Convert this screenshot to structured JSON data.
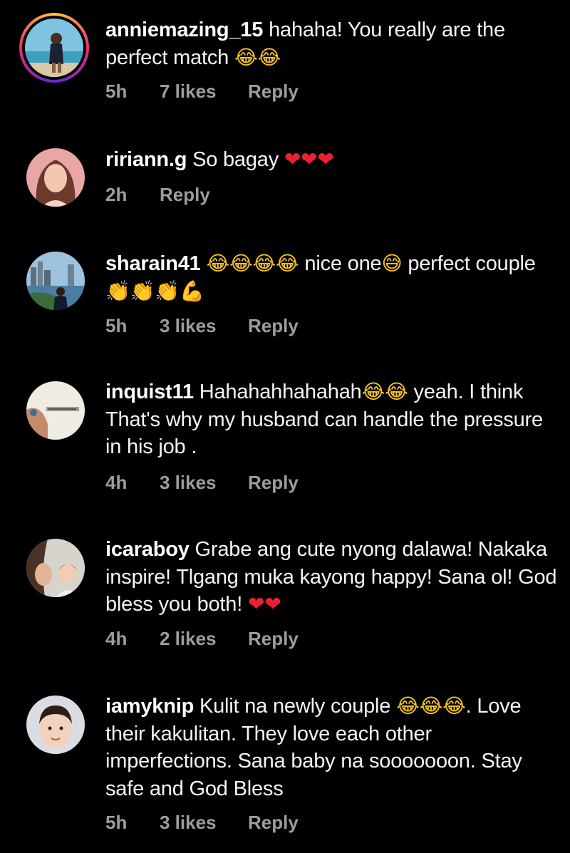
{
  "comments": [
    {
      "username": "anniemazing_15",
      "text": "hahaha! You really are the perfect match",
      "emoji": "😂😂",
      "time": "5h",
      "likes": "7 likes",
      "reply": "Reply",
      "avatar_icon": "profile-photo-beach"
    },
    {
      "username": "ririann.g",
      "text": "So bagay",
      "emoji": "❤❤❤",
      "time": "2h",
      "likes": "",
      "reply": "Reply",
      "avatar_icon": "profile-photo-woman"
    },
    {
      "username": "sharain41",
      "emoji_a": "😂😂😂😂",
      "text_a": "nice one",
      "emoji_b": "😅",
      "text_b": "perfect couple",
      "emoji_c": "👏👏👏💪",
      "time": "5h",
      "likes": "3 likes",
      "reply": "Reply",
      "avatar_icon": "profile-photo-city"
    },
    {
      "username": "inquist11",
      "text_a": "Hahahahhahahah",
      "emoji": "😂😂",
      "text_b": "yeah. I think That's why  my husband can handle the pressure in his job .",
      "time": "4h",
      "likes": "3 likes",
      "reply": "Reply",
      "avatar_icon": "profile-photo-arm"
    },
    {
      "username": "icaraboy",
      "text": "Grabe ang cute nyong dalawa! Nakaka inspire! Tlgang muka kayong happy! Sana ol! God bless you both!",
      "emoji": "❤❤",
      "time": "4h",
      "likes": "2 likes",
      "reply": "Reply",
      "avatar_icon": "profile-photo-mother-child"
    },
    {
      "username": "iamyknip",
      "text_a": "Kulit na newly couple",
      "emoji": "😂😂😂",
      "text_b": ". Love their kakulitan. They love each other imperfections. Sana baby na sooooooon. Stay safe and God Bless",
      "time": "5h",
      "likes": "3 likes",
      "reply": "Reply",
      "avatar_icon": "profile-photo-child"
    }
  ],
  "colors": {
    "background": "#000000",
    "text": "#f5f5f5",
    "meta": "#9d9d9d",
    "heart": "#e8232f"
  }
}
